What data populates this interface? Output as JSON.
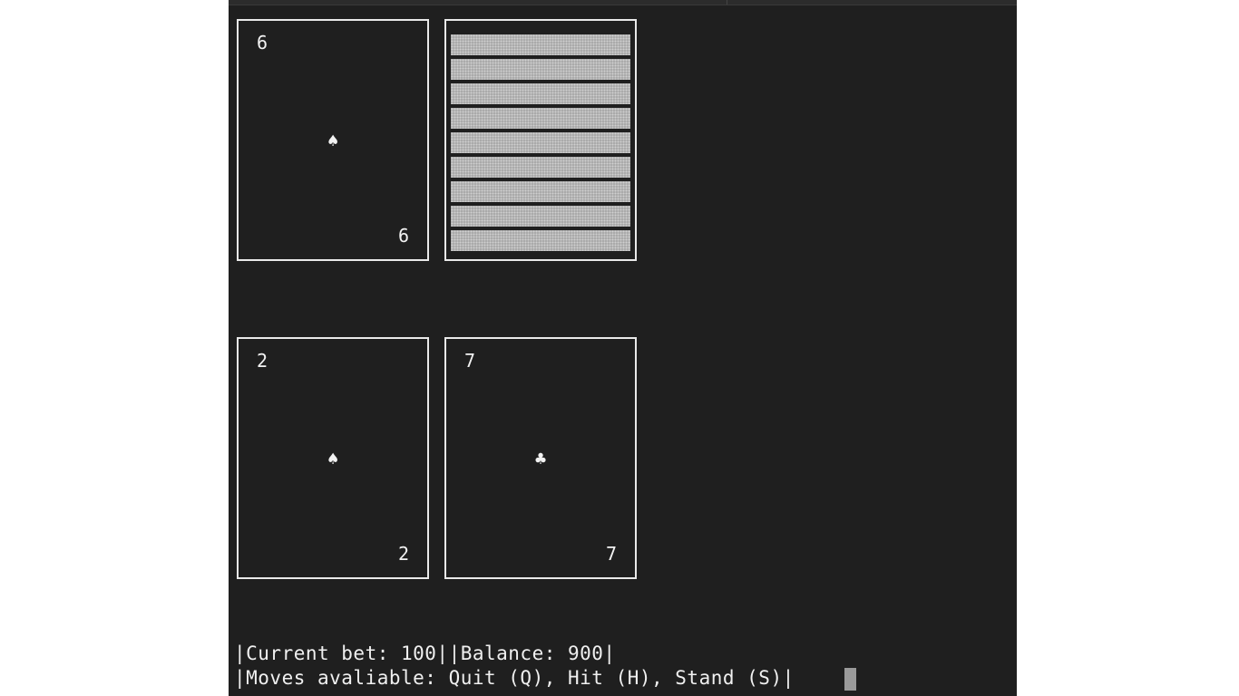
{
  "dealer": {
    "cards": [
      {
        "rank": "6",
        "suit": "♠",
        "face_down": false
      },
      {
        "face_down": true
      }
    ]
  },
  "player": {
    "cards": [
      {
        "rank": "2",
        "suit": "♠",
        "face_down": false
      },
      {
        "rank": "7",
        "suit": "♣",
        "face_down": false
      }
    ]
  },
  "status": {
    "bet_line": "|Current bet: 100||Balance: 900|",
    "moves_line": "|Moves avaliable: Quit (Q), Hit (H), Stand (S)|"
  },
  "colors": {
    "background": "#1f1f1f",
    "card_border": "#e9e9e9",
    "text": "#f0f0f0",
    "card_back": "#a9a9a9",
    "cursor": "#9a9a9a"
  }
}
